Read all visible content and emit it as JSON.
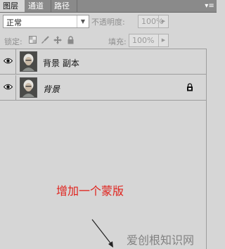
{
  "tabs": [
    {
      "label": "图层",
      "active": true
    },
    {
      "label": "通道",
      "active": false
    },
    {
      "label": "路径",
      "active": false
    }
  ],
  "panel_menu_icon": "panel-menu-icon",
  "blend_mode": {
    "value": "正常"
  },
  "opacity": {
    "label": "不透明度:",
    "value": "100%"
  },
  "lock": {
    "label": "锁定:",
    "icons": [
      "lock-transparent-icon",
      "brush-icon",
      "move-icon",
      "lock-all-icon"
    ]
  },
  "fill": {
    "label": "填充:",
    "value": "100%"
  },
  "layers": [
    {
      "name": "背景 副本",
      "visible": true,
      "locked": false,
      "italic": false
    },
    {
      "name": "背景",
      "visible": true,
      "locked": true,
      "italic": true
    }
  ],
  "annotation": {
    "text": "增加一个蒙版",
    "color": "#e0221c"
  },
  "watermark": {
    "text": "爱创根知识网"
  }
}
